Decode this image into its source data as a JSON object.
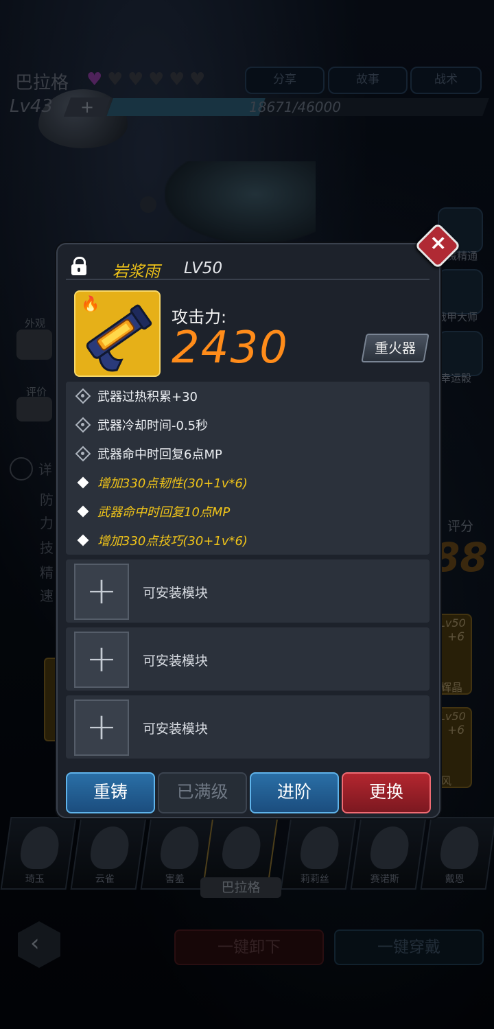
{
  "hero": {
    "name": "巴拉格",
    "hearts_filled": 1,
    "hearts_total": 6,
    "level": "Lv43",
    "plus": "+",
    "exp_text": "18671/46000",
    "exp_progress": 0.406
  },
  "top_buttons": [
    "分享",
    "故事",
    "战术"
  ],
  "side_skills": [
    "机械精通",
    "战甲大师",
    "幸运骰"
  ],
  "left_tabs": {
    "appearance": "外观",
    "rating": "评价",
    "detail": "详",
    "stats": [
      "防",
      "力",
      "技",
      "精",
      "速"
    ]
  },
  "score": {
    "label": "评分",
    "value": "88"
  },
  "side_cards": [
    {
      "lv": "Lv50",
      "plus": "+6",
      "name": "辉晶"
    },
    {
      "lv": "Lv50",
      "plus": "+6",
      "name": "风"
    }
  ],
  "modal": {
    "item_name": "岩浆雨",
    "item_level": "LV50",
    "attack_label": "攻击力:",
    "attack_value": "2430",
    "weapon_type": "重火器",
    "attributes": [
      {
        "text": "武器过热积累+30",
        "icon": "gear-icon",
        "style": "normal"
      },
      {
        "text": "武器冷却时间-0.5秒",
        "icon": "gear-icon",
        "style": "normal"
      },
      {
        "text": "武器命中时回复6点MP",
        "icon": "gear-icon",
        "style": "normal"
      },
      {
        "text": "增加330点韧性(30+1v*6)",
        "icon": "diamond-icon",
        "style": "gold"
      },
      {
        "text": "武器命中时回复10点MP",
        "icon": "diamond-icon",
        "style": "gold"
      },
      {
        "text": "增加330点技巧(30+1v*6)",
        "icon": "diamond-icon",
        "style": "gold"
      }
    ],
    "module_slots": [
      "可安装模块",
      "可安装模块",
      "可安装模块"
    ],
    "actions": {
      "recast": "重铸",
      "maxed": "已满级",
      "advance": "进阶",
      "replace": "更换"
    },
    "close_icon": "close-icon"
  },
  "hero_list": [
    {
      "name": "琦玉",
      "selected": false
    },
    {
      "name": "云雀",
      "selected": false
    },
    {
      "name": "害羞",
      "selected": false
    },
    {
      "name": "巴拉格",
      "selected": true
    },
    {
      "name": "莉莉丝",
      "selected": false
    },
    {
      "name": "赛诺斯",
      "selected": false
    },
    {
      "name": "戴恩",
      "selected": false
    }
  ],
  "bottom": {
    "unequip_all": "一键卸下",
    "equip_all": "一键穿戴"
  },
  "colors": {
    "gold": "#f0c419",
    "attack": "#ff8c1a",
    "blue_button": "#1b4d7e",
    "red_button": "#b3262f"
  }
}
